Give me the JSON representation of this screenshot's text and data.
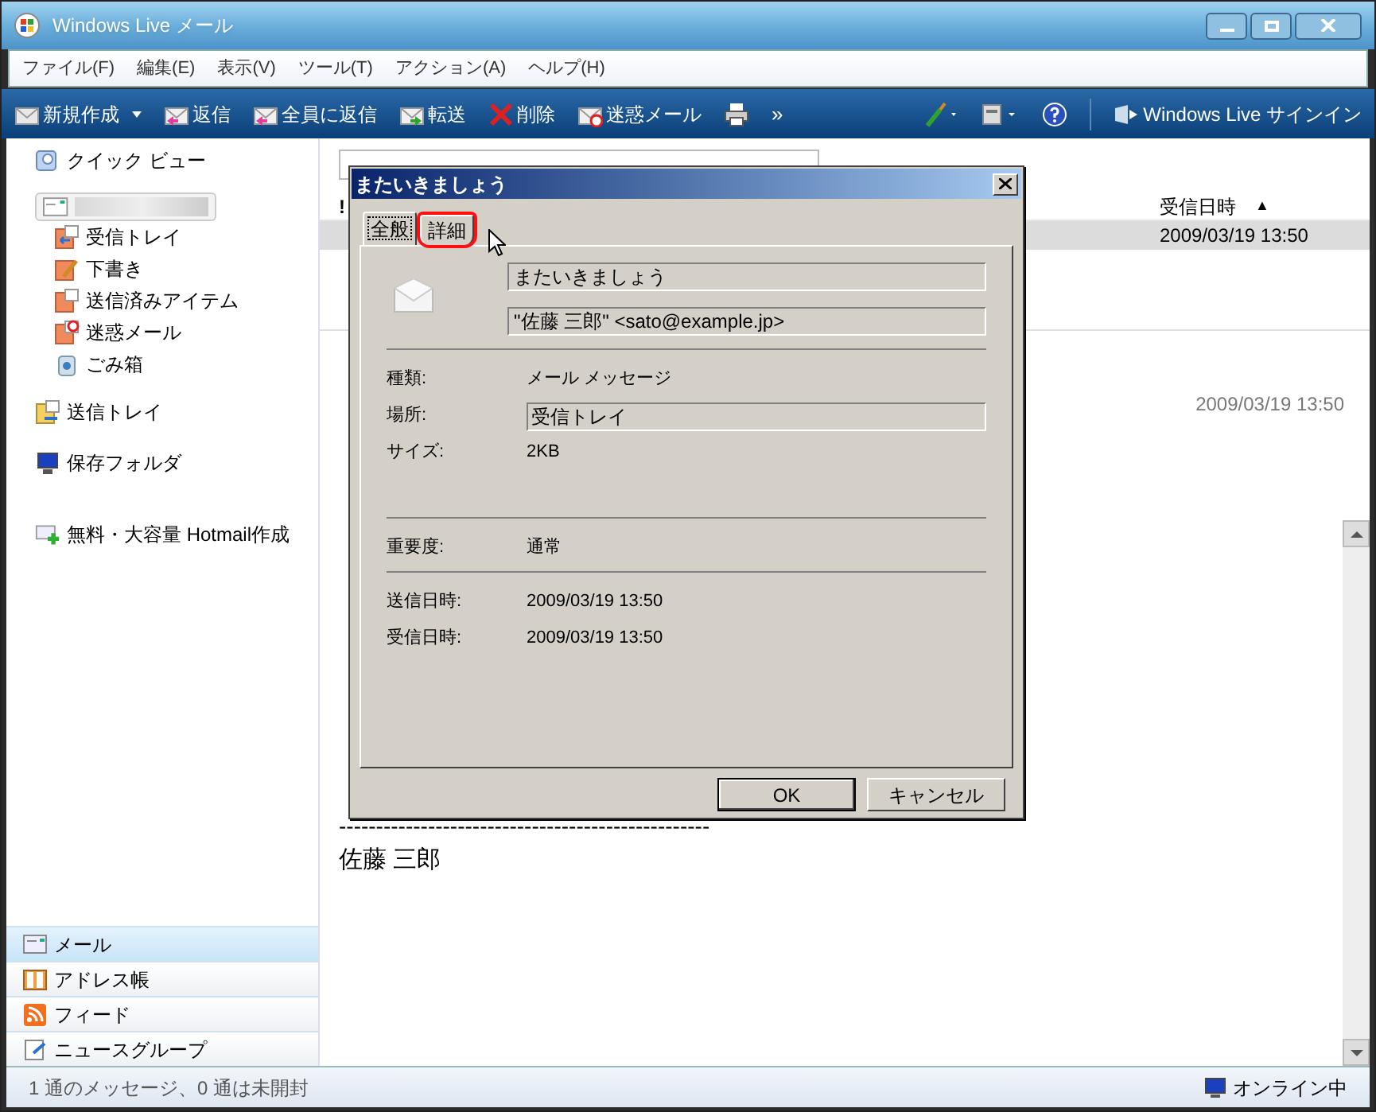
{
  "window": {
    "title": "Windows Live メール"
  },
  "menu": [
    "ファイル(F)",
    "編集(E)",
    "表示(V)",
    "ツール(T)",
    "アクション(A)",
    "ヘルプ(H)"
  ],
  "toolbar": [
    {
      "label": "新規作成",
      "dropdown": true
    },
    {
      "label": "返信",
      "dropdown": false
    },
    {
      "label": "全員に返信",
      "dropdown": false
    },
    {
      "label": "転送",
      "dropdown": false
    },
    {
      "label": "削除",
      "dropdown": false
    },
    {
      "label": "迷惑メール",
      "dropdown": false
    }
  ],
  "toolbar_overflow": "»",
  "signin": "Windows Live サインイン",
  "sidebar": {
    "quick_view": "クイック ビュー",
    "folders": [
      {
        "label": "受信トレイ"
      },
      {
        "label": "下書き"
      },
      {
        "label": "送信済みアイテム"
      },
      {
        "label": "迷惑メール"
      },
      {
        "label": "ごみ箱"
      }
    ],
    "items": [
      "送信トレイ",
      "保存フォルダ",
      "無料・大容量 Hotmail作成"
    ],
    "nav": [
      {
        "label": "メール",
        "selected": true
      },
      {
        "label": "アドレス帳",
        "selected": false
      },
      {
        "label": "フィード",
        "selected": false
      },
      {
        "label": "ニュースグループ",
        "selected": false
      }
    ]
  },
  "message_list": {
    "columns": [
      "!",
      "受信日時"
    ],
    "sort_arrow": "▲",
    "rows": [
      {
        "date": "2009/03/19 13:50",
        "selected": true
      }
    ]
  },
  "reading_pane": {
    "date": "2009/03/19 13:50",
    "separator": "--------------------------------------------------",
    "signature": "佐藤 三郎"
  },
  "dialog": {
    "title": "またいきましょう",
    "tabs": [
      {
        "label": "全般",
        "selected": true,
        "highlighted": false
      },
      {
        "label": "詳細",
        "selected": false,
        "highlighted": true
      }
    ],
    "subject": "またいきましょう",
    "from": "\"佐藤 三郎\" <sato@example.jp>",
    "groups": [
      [
        {
          "label": "種類:",
          "value": "メール メッセージ",
          "kind": "text"
        },
        {
          "label": "場所:",
          "value": "受信トレイ",
          "kind": "field"
        },
        {
          "label": "サイズ:",
          "value": "2KB",
          "kind": "text"
        }
      ],
      [
        {
          "label": "重要度:",
          "value": "通常",
          "kind": "text"
        }
      ],
      [
        {
          "label": "送信日時:",
          "value": "2009/03/19 13:50",
          "kind": "text"
        },
        {
          "label": "受信日時:",
          "value": "2009/03/19 13:50",
          "kind": "text"
        }
      ]
    ],
    "buttons": [
      {
        "label": "OK",
        "default": true
      },
      {
        "label": "キャンセル",
        "default": false
      }
    ]
  },
  "status_bar": {
    "text": "1 通のメッセージ、0 通は未開封",
    "connection": "オンライン中"
  }
}
